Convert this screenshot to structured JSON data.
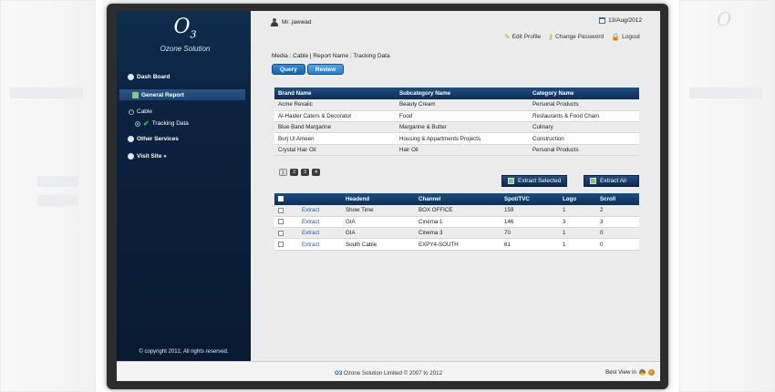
{
  "app": {
    "logo_mark": "O",
    "logo_sub": "3",
    "logo_text": "Ozone Solution"
  },
  "sidebar": {
    "items": [
      {
        "label": "Dash Board"
      },
      {
        "label": "General Report"
      },
      {
        "label": "Other Services"
      },
      {
        "label": "Visit Site »"
      }
    ],
    "sub_group": "Cable",
    "sub_item": "Tracking Data",
    "copyright": "© copyright 2012, All rights reserved."
  },
  "header": {
    "user": "Mr. jawwad",
    "date": "13/Aug/2012",
    "links": [
      "Edit Profile",
      "Change Password",
      "Logout"
    ]
  },
  "breadcrumb": "Media : Cable | Report Name : Tracking Data",
  "tabs": [
    "Query",
    "Review"
  ],
  "brand_table": {
    "columns": [
      "Brand Name",
      "Subcategory Name",
      "Category Name"
    ],
    "rows": [
      [
        "Acme Rexalic",
        "Beauty Cream",
        "Personal Products"
      ],
      [
        "Al-Haider Caters & Decorator",
        "Food",
        "Restaurants & Food Chain"
      ],
      [
        "Blue Band Margarine",
        "Margarine & Butter",
        "Culinary"
      ],
      [
        "Burj Ul Ameen",
        "Housing & Appartments Projects",
        "Construction"
      ],
      [
        "Crystal Hair Oil",
        "Hair Oil",
        "Personal Products"
      ]
    ],
    "pages": [
      "1",
      "2",
      "3",
      "4"
    ],
    "current_page": "1"
  },
  "actions": {
    "extract_selected": "Extract Selected",
    "extract_all": "Extract All"
  },
  "tracking_table": {
    "columns": [
      "",
      "",
      "Headend",
      "Channel",
      "Spot/TVC",
      "Logo",
      "Scroll"
    ],
    "rows": [
      {
        "action": "Extract",
        "headend": "Show Time",
        "channel": "BOX OFFICE",
        "spot": "159",
        "logo": "1",
        "scroll": "2"
      },
      {
        "action": "Extract",
        "headend": "GIA",
        "channel": "Cinema 1",
        "spot": "146",
        "logo": "3",
        "scroll": "3"
      },
      {
        "action": "Extract",
        "headend": "GIA",
        "channel": "Cinema 3",
        "spot": "70",
        "logo": "1",
        "scroll": "0"
      },
      {
        "action": "Extract",
        "headend": "South Cable",
        "channel": "EXPY4-SOUTH",
        "spot": "61",
        "logo": "1",
        "scroll": "0"
      }
    ]
  },
  "footer": {
    "brand": "O3",
    "text": "Ozone Solution Limited © 2007 to 2012",
    "best_view": "Best View in"
  },
  "colors": {
    "sidebar": "#0b2340",
    "header_row": "#0c2e55",
    "accent": "#1563b5",
    "link": "#1f5fae"
  }
}
